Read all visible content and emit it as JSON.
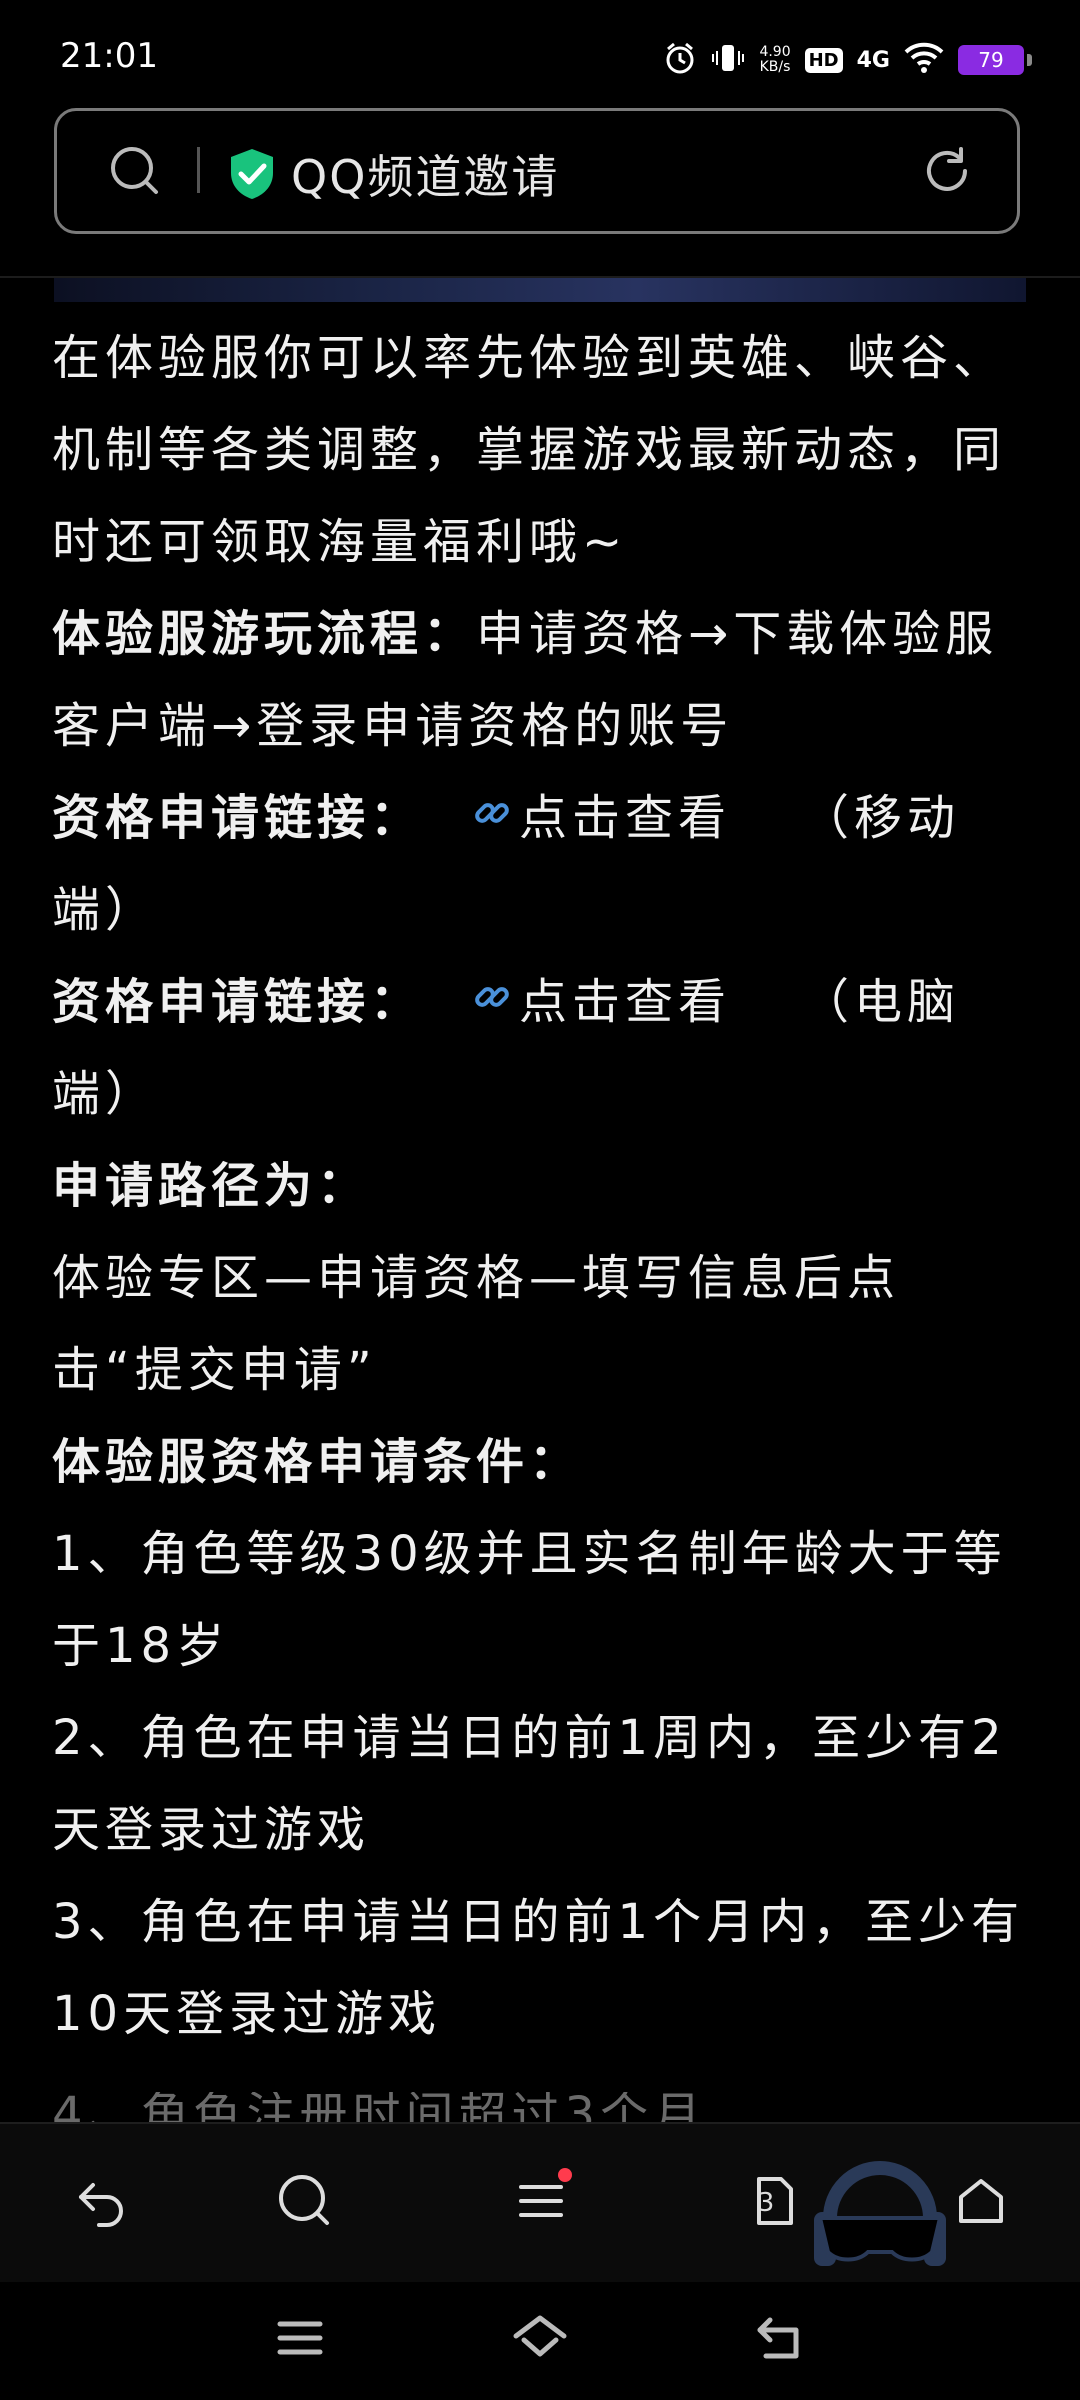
{
  "status_bar": {
    "time": "21:01",
    "net_speed_value": "4.90",
    "net_speed_unit": "KB/s",
    "hd_label": "HD",
    "network_label": "4G",
    "battery_level": "79",
    "battery_color": "#8a2be2"
  },
  "address_bar": {
    "title": "QQ频道邀请",
    "secure_color": "#19c37d"
  },
  "article": {
    "intro": "在体验服你可以率先体验到英雄、峡谷、机制等各类调整，掌握游戏最新动态，同时还可领取海量福利哦~",
    "flow_label": "体验服游玩流程：",
    "flow_text": "申请资格→下载体验服客户端→登录申请资格的账号",
    "apply_link_label_1": "资格申请链接：",
    "link_text_1": "点击查看",
    "link_suffix_1": "（移动端）",
    "apply_link_label_2": "资格申请链接：",
    "link_text_2": "点击查看",
    "link_suffix_2": "（电脑端）",
    "path_label": "申请路径为：",
    "path_text": "体验专区—申请资格—填写信息后点击“提交申请”",
    "conditions_label": "体验服资格申请条件：",
    "conditions": [
      "1、角色等级30级并且实名制年龄大于等于18岁",
      "2、角色在申请当日的前1周内，至少有2天登录过游戏",
      "3、角色在申请当日的前1个月内，至少有10天登录过游戏"
    ],
    "partial_line": "4、角色注册时间超过3个月",
    "link_color": "#4a90d9"
  },
  "bottom_nav": {
    "tab_count": "3",
    "menu_badge_color": "#ff3b4d"
  }
}
